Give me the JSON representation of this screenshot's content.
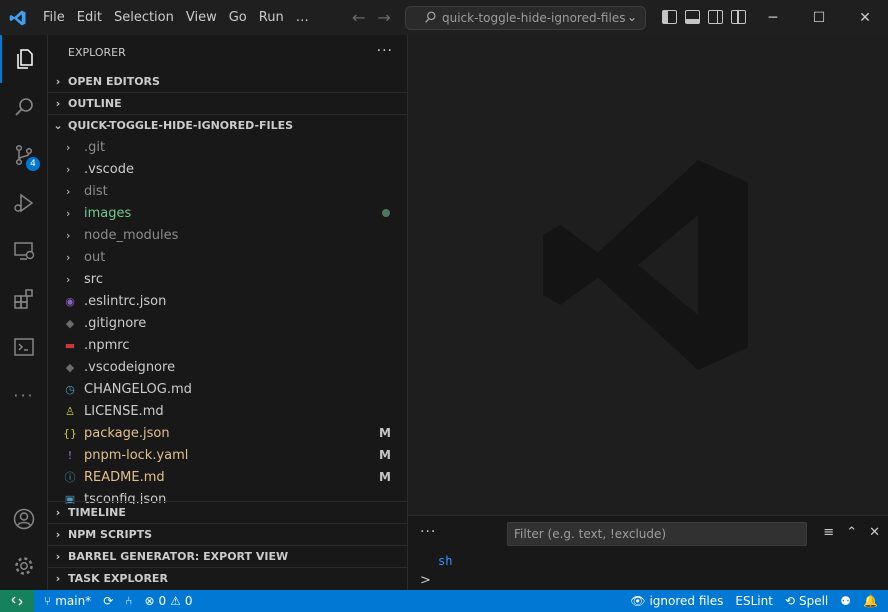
{
  "menu": [
    "File",
    "Edit",
    "Selection",
    "View",
    "Go",
    "Run",
    "…"
  ],
  "command_center": {
    "text": "quick-toggle-hide-ignored-files"
  },
  "activity": {
    "scm_badge": "4"
  },
  "explorer": {
    "title": "EXPLORER",
    "sections_top": [
      "OPEN EDITORS",
      "OUTLINE"
    ],
    "project": "QUICK-TOGGLE-HIDE-IGNORED-FILES",
    "items": [
      {
        "name": ".git",
        "type": "folder",
        "color": "dim",
        "status": ""
      },
      {
        "name": ".vscode",
        "type": "folder",
        "color": "white",
        "status": ""
      },
      {
        "name": "dist",
        "type": "folder",
        "color": "dim",
        "status": ""
      },
      {
        "name": "images",
        "type": "folder",
        "color": "green",
        "status": "dot"
      },
      {
        "name": "node_modules",
        "type": "folder",
        "color": "dim",
        "status": ""
      },
      {
        "name": "out",
        "type": "folder",
        "color": "dim",
        "status": ""
      },
      {
        "name": "src",
        "type": "folder",
        "color": "white",
        "status": ""
      },
      {
        "name": ".eslintrc.json",
        "type": "file",
        "icon": "eslint-icon",
        "color": "white",
        "status": ""
      },
      {
        "name": ".gitignore",
        "type": "file",
        "icon": "git-icon",
        "color": "white",
        "status": ""
      },
      {
        "name": ".npmrc",
        "type": "file",
        "icon": "npm-icon",
        "color": "white",
        "status": ""
      },
      {
        "name": ".vscodeignore",
        "type": "file",
        "icon": "vscode-icon",
        "color": "white",
        "status": ""
      },
      {
        "name": "CHANGELOG.md",
        "type": "file",
        "icon": "changelog-icon",
        "color": "white",
        "status": ""
      },
      {
        "name": "LICENSE.md",
        "type": "file",
        "icon": "license-icon",
        "color": "white",
        "status": ""
      },
      {
        "name": "package.json",
        "type": "file",
        "icon": "json-icon",
        "color": "yellow",
        "status": "M"
      },
      {
        "name": "pnpm-lock.yaml",
        "type": "file",
        "icon": "yaml-icon",
        "color": "yellow",
        "status": "M"
      },
      {
        "name": "README.md",
        "type": "file",
        "icon": "info-icon",
        "color": "yellow",
        "status": "M"
      },
      {
        "name": "tsconfig.json",
        "type": "file",
        "icon": "ts-icon",
        "color": "white",
        "status": ""
      }
    ],
    "sections_bottom": [
      "TIMELINE",
      "NPM SCRIPTS",
      "BARREL GENERATOR: EXPORT VIEW",
      "TASK EXPLORER"
    ]
  },
  "panel": {
    "filter_placeholder": "Filter (e.g. text, !exclude)",
    "terminal_line": "sh",
    "prompt": ">"
  },
  "status": {
    "branch": "main*",
    "errors": "0",
    "warnings": "0",
    "ignored": "ignored files",
    "eslint": "ESLint",
    "spell": "Spell"
  },
  "colors": {
    "accent": "#0078d4",
    "remote": "#16825d"
  }
}
